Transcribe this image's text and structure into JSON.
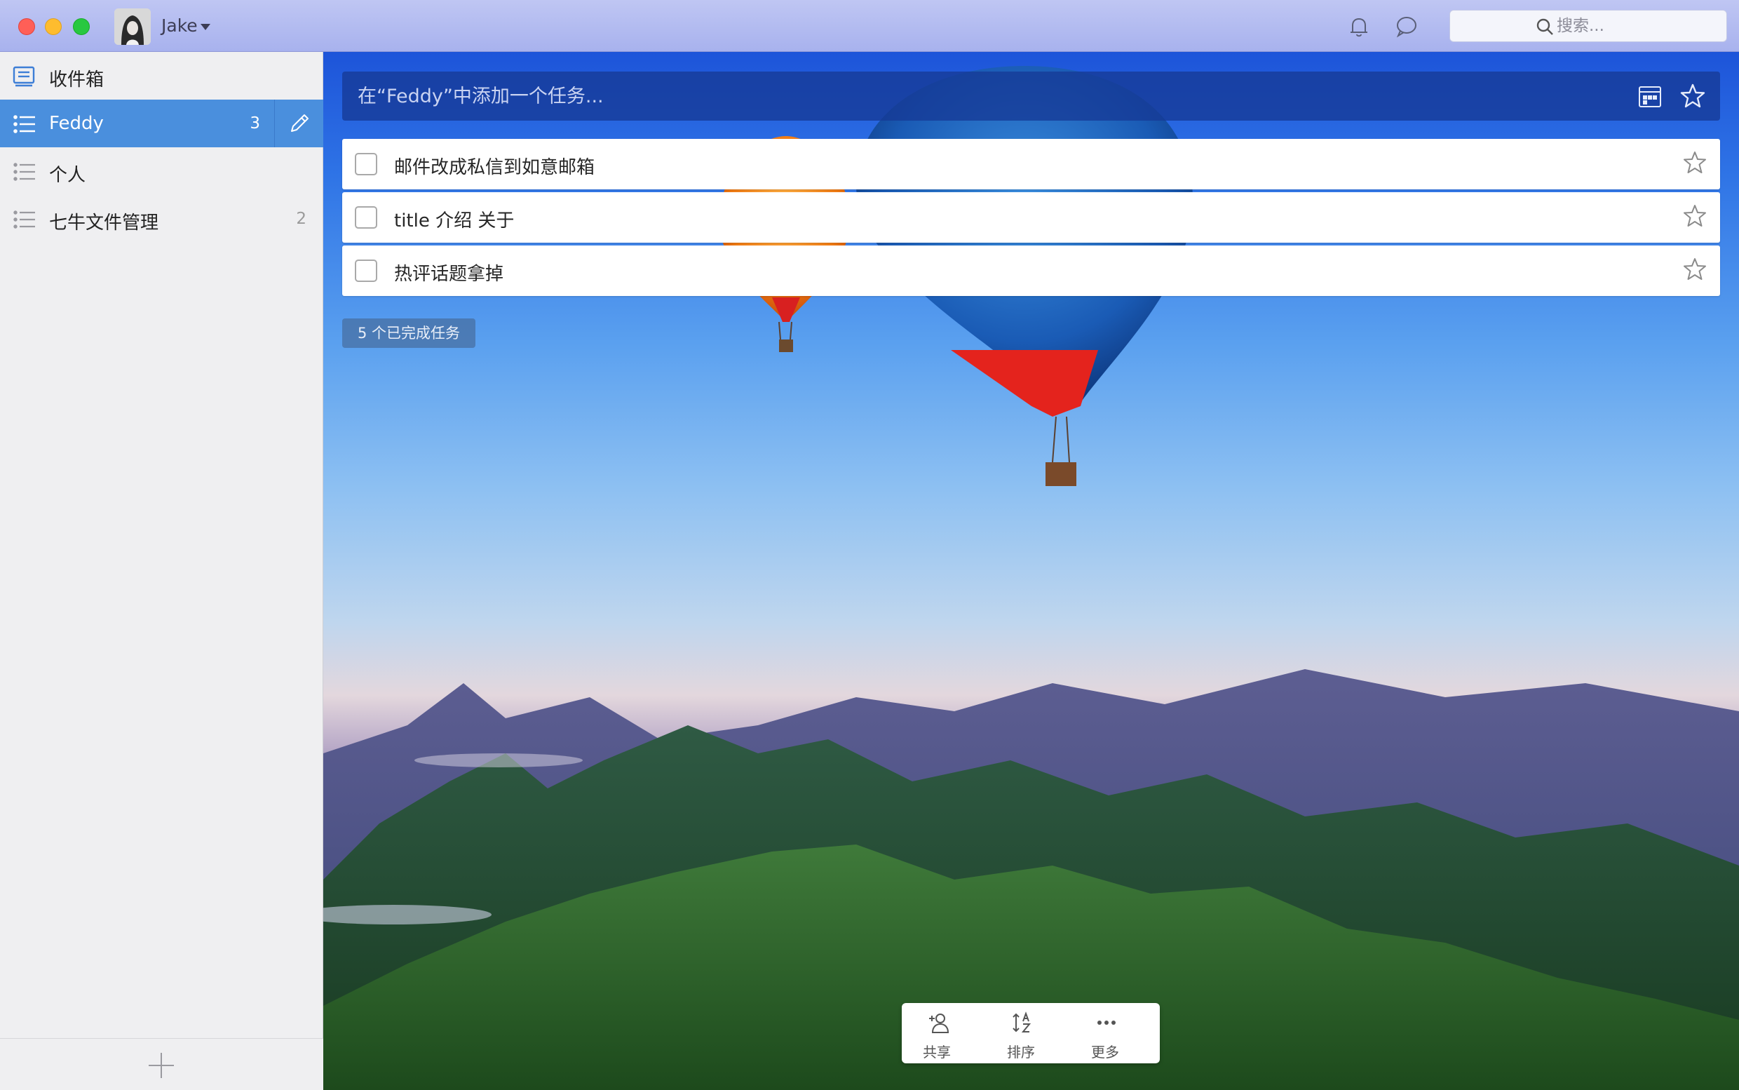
{
  "titlebar": {
    "user_name": "Jake",
    "search_placeholder": "搜索..."
  },
  "sidebar": {
    "items": [
      {
        "label": "收件箱",
        "count": "",
        "icon": "inbox-icon"
      },
      {
        "label": "Feddy",
        "count": "3",
        "icon": "list-icon",
        "active": true
      },
      {
        "label": "个人",
        "count": "",
        "icon": "list-icon"
      },
      {
        "label": "七牛文件管理",
        "count": "2",
        "icon": "list-icon"
      }
    ]
  },
  "main": {
    "add_task_placeholder": "在“Feddy”中添加一个任务...",
    "tasks": [
      {
        "label": "邮件改成私信到如意邮箱"
      },
      {
        "label": "title 介绍 关于"
      },
      {
        "label": "热评话题拿掉"
      }
    ],
    "completed_label": "5 个已完成任务",
    "toolbar": {
      "share_label": "共享",
      "sort_label": "排序",
      "more_label": "更多"
    }
  },
  "colors": {
    "accent": "#4a8fdd",
    "sidebar_bg": "#efeff1",
    "titlebar_bg": "#b4bcf0"
  }
}
